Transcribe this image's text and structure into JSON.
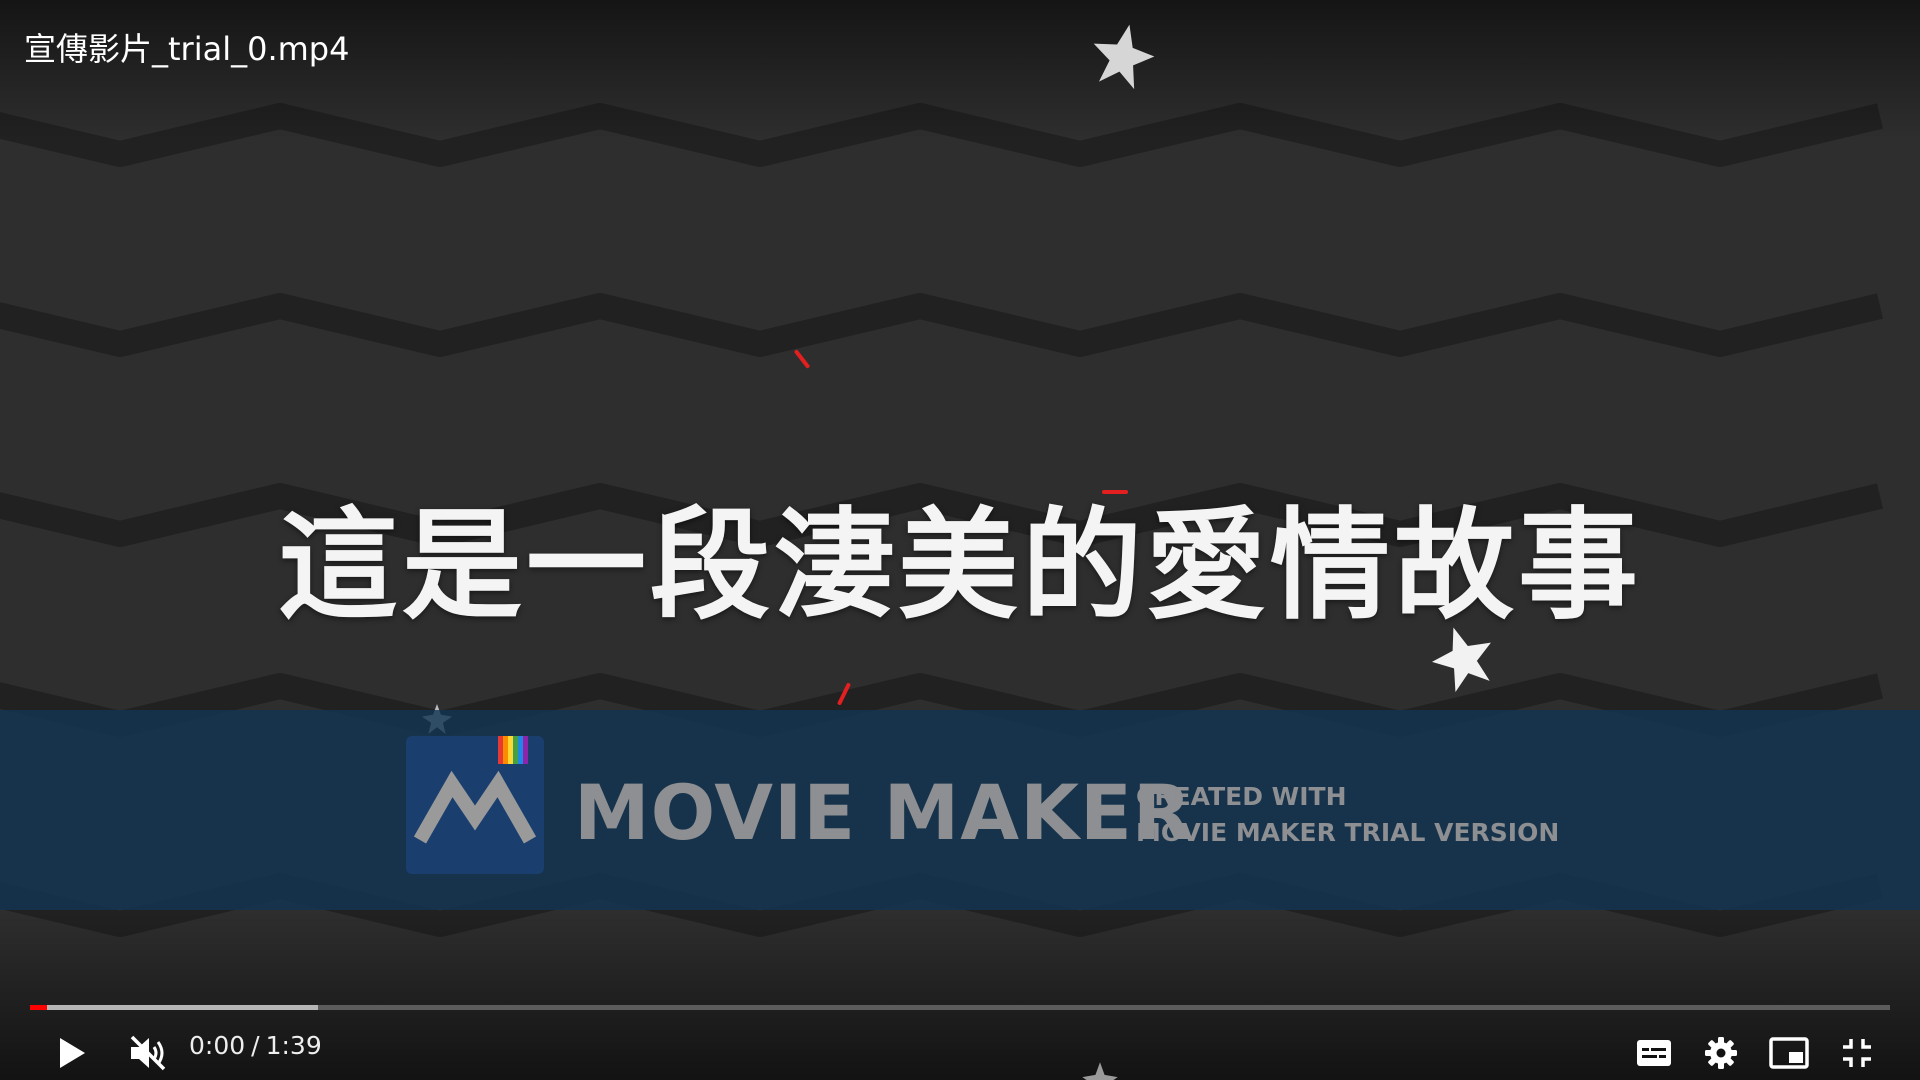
{
  "video": {
    "title": "宣傳影片_trial_0.mp4",
    "subtitle": "這是一段淒美的愛情故事"
  },
  "watermark": {
    "brand": "MOVIE MAKER",
    "line1": "CREATED WITH",
    "line2": "MOVIE MAKER TRIAL VERSION"
  },
  "player": {
    "current_time": "0:00",
    "separator": "/",
    "duration": "1:39",
    "progress_fraction": 0.009,
    "buffered_fraction": 0.155,
    "accent_color": "#ff0000",
    "state": "paused",
    "muted": true,
    "controls": {
      "left": [
        "play-icon",
        "mute-icon"
      ],
      "right": [
        "subtitles-icon",
        "settings-icon",
        "miniplayer-icon",
        "exit-fullscreen-icon"
      ]
    }
  },
  "colors": {
    "background": "#2e2e2e",
    "wave": "#1f1f1f",
    "watermark_band": "#123452",
    "spark": "#e41f1f"
  }
}
